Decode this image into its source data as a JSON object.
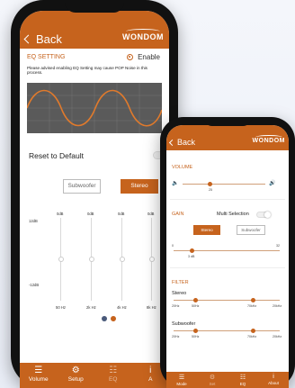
{
  "phone_a": {
    "back_label": "Back",
    "logo": "WONDOM",
    "eq_setting": "EQ SETTING",
    "enable": "Enable",
    "note": "Please advised enabling EQ Setting may cause POP Noise in this process.",
    "reset": "Reset to Default",
    "subwoofer": "Subwoofer",
    "stereo": "Stereo",
    "db_top": [
      "0dB",
      "0dB",
      "0dB",
      "0dB"
    ],
    "db_left_top": "12dB",
    "db_left_bottom": "-12dB",
    "freqs": [
      "50 Hz",
      "2k Hz",
      "4k Hz",
      "8k Hz"
    ],
    "nav": [
      {
        "label": "Volume",
        "icon": "list-icon"
      },
      {
        "label": "Setup",
        "icon": "gear-icon"
      },
      {
        "label": "EQ",
        "icon": "sliders-icon"
      },
      {
        "label": "A",
        "icon": "info-icon"
      }
    ]
  },
  "phone_b": {
    "back_label": "Back",
    "logo": "WONDOM",
    "volume": "VOLUME",
    "vol_value": "25",
    "gain": "GAIN",
    "multi_selection": "Multi Selection",
    "stereo": "Stereo",
    "subwoofer": "Subwoofer",
    "gain_min": "0",
    "gain_max": "32",
    "gain_value": "3 dB",
    "filter": "FILTER",
    "stereo_label": "Stereo",
    "stereo_ticks": [
      "20Hz",
      "50Hz",
      "70kHz",
      "20kHz"
    ],
    "subwoofer_label": "Subwoofer",
    "sub_ticks": [
      "20Hz",
      "50Hz",
      "70kHz",
      "20kHz"
    ],
    "nav": [
      {
        "label": "Mode",
        "icon": "list-icon"
      },
      {
        "label": "Set",
        "icon": "gear-icon"
      },
      {
        "label": "EQ",
        "icon": "sliders-icon"
      },
      {
        "label": "About",
        "icon": "info-icon"
      }
    ]
  },
  "colors": {
    "accent": "#c6631d",
    "wave_bg": "#5a5a5a",
    "wave": "#e07a2c"
  }
}
